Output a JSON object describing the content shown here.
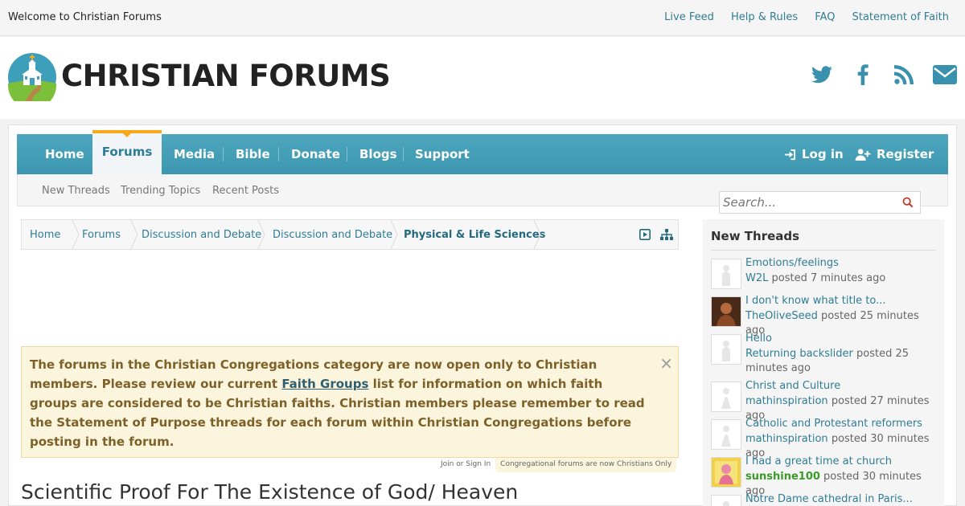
{
  "top": {
    "welcome": "Welcome to Christian Forums",
    "links": [
      "Live Feed",
      "Help & Rules",
      "FAQ",
      "Statement of Faith"
    ]
  },
  "header": {
    "logo_text": "CHRISTIAN FORUMS",
    "social_icons": [
      "twitter-icon",
      "facebook-icon",
      "rss-icon",
      "envelope-icon"
    ]
  },
  "nav": {
    "items": [
      "Home",
      "Forums",
      "Media",
      "Bible",
      "Donate",
      "Blogs",
      "Support"
    ],
    "active": "Forums",
    "login": "Log in",
    "register": "Register"
  },
  "subnav": [
    "New Threads",
    "Trending Topics",
    "Recent Posts"
  ],
  "search": {
    "placeholder": "Search..."
  },
  "breadcrumb": [
    "Home",
    "Forums",
    "Discussion and Debate",
    "Discussion and Debate",
    "Physical & Life Sciences"
  ],
  "notice": {
    "text_before": "The forums in the Christian Congregations category are now open only to Christian members. Please review our current ",
    "link": "Faith Groups",
    "text_after": " list for information on which faith groups are considered to be Christian faiths. Christian members please remember to read the Statement of Purpose threads for each forum within Christian Congregations before posting in the forum.",
    "close": "×",
    "tabs": [
      "Join or Sign In",
      "Congregational forums are now Christians Only"
    ]
  },
  "thread_title": "Scientific Proof For The Existence of God/ Heaven",
  "sidebar": {
    "title": "New Threads",
    "posted_word": "posted",
    "threads": [
      {
        "title": "Emotions/feelings",
        "user": "W2L",
        "time": "7 minutes ago"
      },
      {
        "title": "I don't know what title to...",
        "user": "TheOliveSeed",
        "time": "25 minutes ago"
      },
      {
        "title": "Hello",
        "user": "Returning backslider",
        "time": "25 minutes ago"
      },
      {
        "title": "Christ and Culture",
        "user": "mathinspiration",
        "time": "27 minutes ago"
      },
      {
        "title": "Catholic and Protestant reformers",
        "user": "mathinspiration",
        "time": "30 minutes ago"
      },
      {
        "title": "I had a great time at church",
        "user": "sunshine100",
        "time": "30 minutes ago"
      },
      {
        "title": "Notre Dame cathedral in Paris..."
      }
    ]
  },
  "colors": {
    "nav": "#45a0b9",
    "accent": "#f7a81b",
    "link": "#2f7d95",
    "notice_bg": "#fbf5dd",
    "notice_text": "#7d6128"
  }
}
